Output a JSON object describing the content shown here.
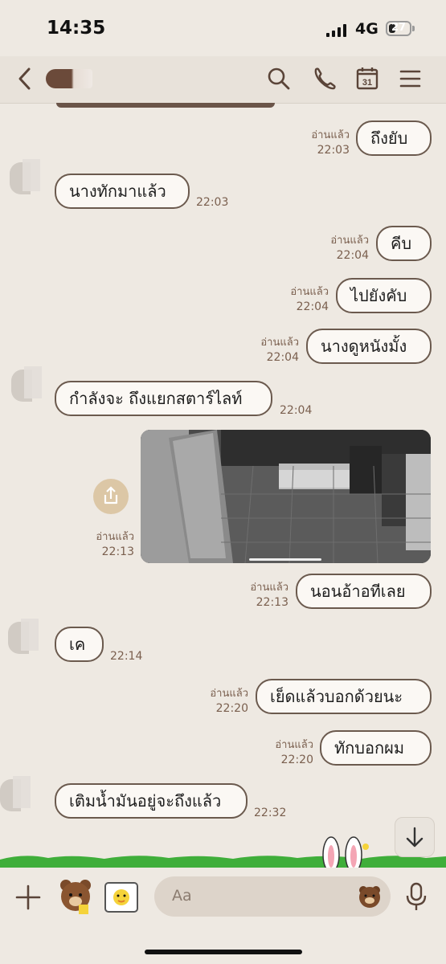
{
  "status": {
    "time": "14:35",
    "network": "4G",
    "battery": "27"
  },
  "header": {
    "back": "back",
    "icons": [
      "search-icon",
      "phone-icon",
      "calendar-icon",
      "menu-icon"
    ],
    "calendar_day": "31"
  },
  "messages": [
    {
      "side": "out",
      "text": "ถึงยับ",
      "read": "อ่านแล้ว",
      "time": "22:03"
    },
    {
      "side": "in",
      "text": "นางทักมาแล้ว",
      "time": "22:03"
    },
    {
      "side": "out",
      "text": "คีบ",
      "read": "อ่านแล้ว",
      "time": "22:04"
    },
    {
      "side": "out",
      "text": "ไปยังคับ",
      "read": "อ่านแล้ว",
      "time": "22:04"
    },
    {
      "side": "out",
      "text": "นางดูหนังมั้ง",
      "read": "อ่านแล้ว",
      "time": "22:04"
    },
    {
      "side": "in",
      "text": "กำลังจะ ถึงแยกสตาร์ไลท์",
      "time": "22:04"
    },
    {
      "side": "out",
      "type": "image",
      "read": "อ่านแล้ว",
      "time": "22:13"
    },
    {
      "side": "out",
      "text": "นอนอ้าอทีเลย",
      "read": "อ่านแล้ว",
      "time": "22:13"
    },
    {
      "side": "in",
      "text": "เค",
      "time": "22:14"
    },
    {
      "side": "out",
      "text": "เย็ดแล้วบอกด้วยนะ",
      "read": "อ่านแล้ว",
      "time": "22:20"
    },
    {
      "side": "out",
      "text": "ทักบอกผม",
      "read": "อ่านแล้ว",
      "time": "22:20"
    },
    {
      "side": "in",
      "text": "เติมน้ำมันอยู่จะถึงแล้ว",
      "time": "22:32"
    }
  ],
  "input": {
    "placeholder": "Aa"
  },
  "colors": {
    "background": "#eee9e2",
    "bubble_border": "#6b5a4e",
    "meta": "#7a5f4e",
    "grass": "#3fae3a"
  }
}
